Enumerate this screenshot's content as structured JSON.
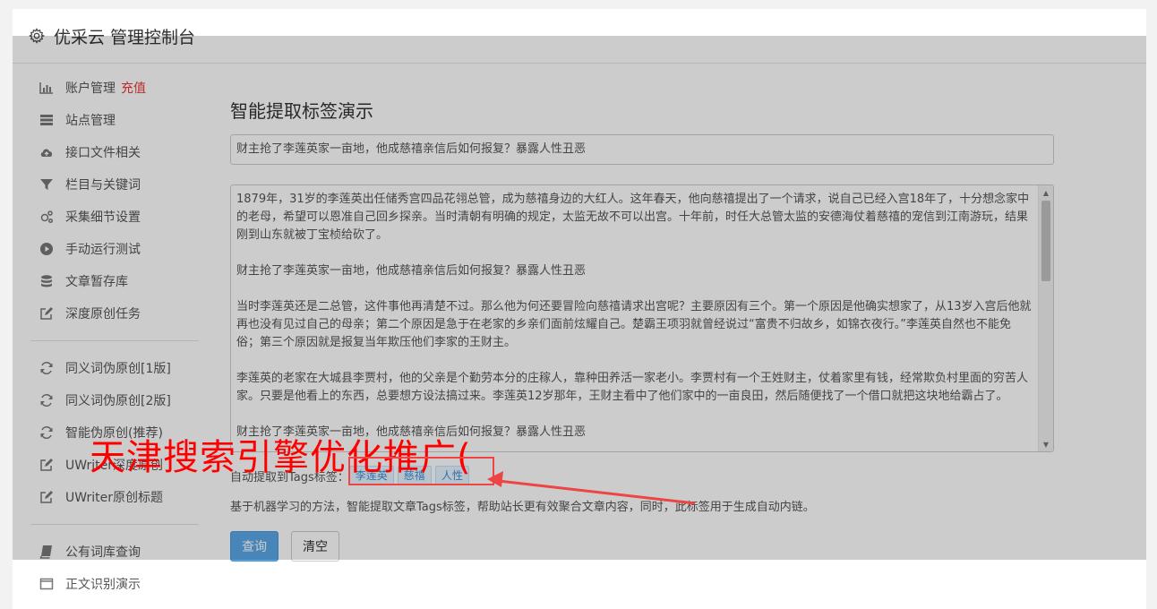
{
  "header": {
    "title": "优采云 管理控制台"
  },
  "sidebar": {
    "group1": [
      {
        "label": "账户管理",
        "extra": "充值",
        "icon": "bar-chart-icon"
      },
      {
        "label": "站点管理",
        "icon": "server-icon"
      },
      {
        "label": "接口文件相关",
        "icon": "cloud-upload-icon"
      },
      {
        "label": "栏目与关键词",
        "icon": "filter-icon"
      },
      {
        "label": "采集细节设置",
        "icon": "gears-icon"
      },
      {
        "label": "手动运行测试",
        "icon": "play-icon"
      },
      {
        "label": "文章暂存库",
        "icon": "database-icon"
      },
      {
        "label": "深度原创任务",
        "icon": "edit-icon"
      }
    ],
    "group2": [
      {
        "label": "同义词伪原创[1版]",
        "icon": "refresh-icon"
      },
      {
        "label": "同义词伪原创[2版]",
        "icon": "refresh-icon"
      },
      {
        "label": "智能伪原创(推荐)",
        "icon": "refresh-icon"
      },
      {
        "label": "UWriter深度原创",
        "icon": "edit-icon"
      },
      {
        "label": "UWriter原创标题",
        "icon": "edit-icon"
      }
    ],
    "group3": [
      {
        "label": "公有词库查询",
        "icon": "book-icon"
      },
      {
        "label": "正文识别演示",
        "icon": "window-icon"
      }
    ]
  },
  "main": {
    "heading": "智能提取标签演示",
    "title_value": "财主抢了李莲英家一亩地，他成慈禧亲信后如何报复？暴露人性丑恶",
    "content_paragraphs": [
      "1879年，31岁的李莲英出任储秀宫四品花翎总管，成为慈禧身边的大红人。这年春天，他向慈禧提出了一个请求，说自己已经入宫18年了，十分想念家中的老母，希望可以恩准自己回乡探亲。当时清朝有明确的规定，太监无故不可以出宫。十年前，时任大总管太监的安德海仗着慈禧的宠信到江南游玩，结果刚到山东就被丁宝桢给砍了。",
      "财主抢了李莲英家一亩地，他成慈禧亲信后如何报复？暴露人性丑恶",
      "当时李莲英还是二总管，这件事他再清楚不过。那么他为何还要冒险向慈禧请求出宫呢？主要原因有三个。第一个原因是他确实想家了，从13岁入宫后他就再也没有见过自己的母亲；第二个原因是急于在老家的乡亲们面前炫耀自己。楚霸王项羽就曾经说过“富贵不归故乡，如锦衣夜行。”李莲英自然也不能免俗；第三个原因就是报复当年欺压他们李家的王财主。",
      "李莲英的老家在大城县李贾村，他的父亲是个勤劳本分的庄稼人，靠种田养活一家老小。李贾村有一个王姓财主，仗着家里有钱，经常欺负村里面的穷苦人家。只要是他看上的东西，总要想方设法搞过来。李莲英12岁那年，王财主看中了他们家中的一亩良田，然后随便找了一个借口就把这块地给霸占了。",
      "财主抢了李莲英家一亩地，他成慈禧亲信后如何报复？暴露人性丑恶"
    ],
    "tags_label": "自动提取到Tags标签：",
    "tags": [
      "李莲英",
      "慈禧",
      "人性"
    ],
    "description": "基于机器学习的方法，智能提取文章Tags标签，帮助站长更有效聚合文章内容，同时，此标签用于生成自动内链。",
    "query_button": "查询",
    "clear_button": "清空"
  },
  "watermark": {
    "text": "天津搜索引擎优化推广("
  }
}
